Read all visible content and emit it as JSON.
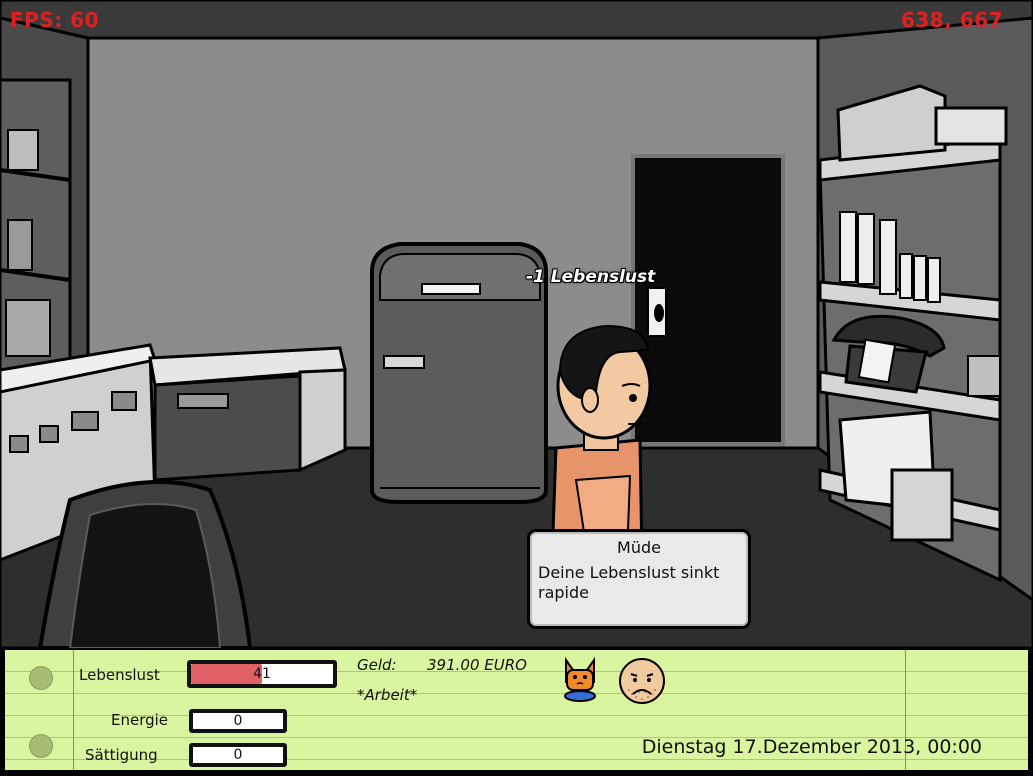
{
  "hud": {
    "fps": "FPS: 60",
    "coordinates": "638, 667"
  },
  "floating_text": "-1 Lebenslust",
  "tooltip": {
    "title": "Müde",
    "text": "Deine Lebenslust sinkt rapide"
  },
  "stats": {
    "lebenslust": {
      "label": "Lebenslust",
      "value": "41",
      "fill_fraction": 0.5
    },
    "energie": {
      "label": "Energie",
      "value": "0",
      "fill_fraction": 0
    },
    "saettigung": {
      "label": "Sättigung",
      "value": "0",
      "fill_fraction": 0
    }
  },
  "money": {
    "label": "Geld:",
    "value": "391.00 EURO"
  },
  "job": "*Arbeit*",
  "status_icons": [
    "hungry-cat-icon",
    "tired-face-icon"
  ],
  "datetime": "Dienstag 17.Dezember 2013, 00:00",
  "colors": {
    "hud_text": "#e02020",
    "panel_bg": "#d9f5a0",
    "lebenslust_fill": "#e06066",
    "player_shirt": "#e8946a"
  }
}
